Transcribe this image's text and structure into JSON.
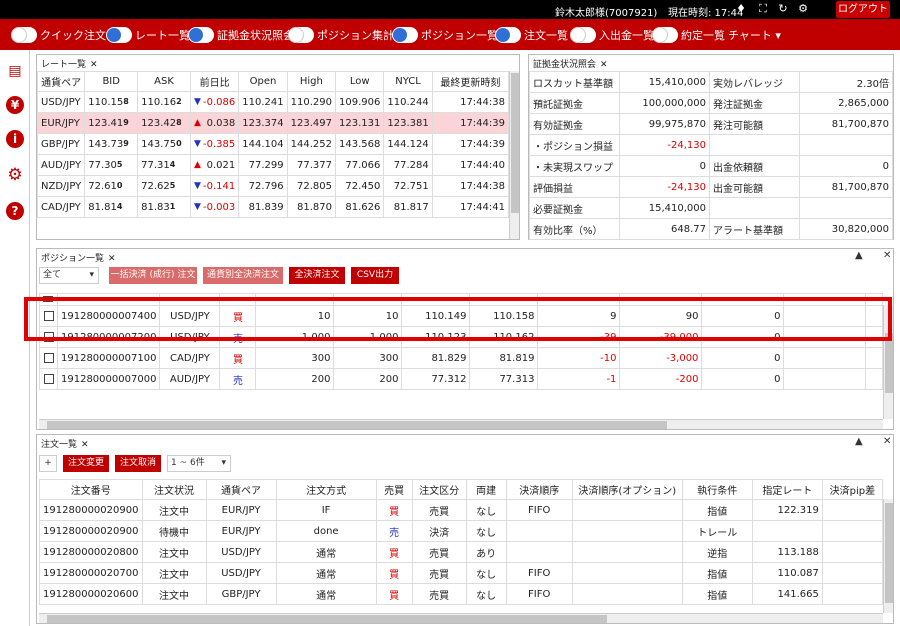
{
  "topbar": {
    "user": "鈴木太郎様(7007921)",
    "clock_label": "現在時刻: 17:44",
    "logout": "ログアウト",
    "icons": [
      "bell-icon",
      "fullscreen-icon",
      "refresh-icon",
      "gear-icon"
    ]
  },
  "toolbar": {
    "toggles": [
      {
        "label": "クイック注文",
        "on": false
      },
      {
        "label": "レート一覧",
        "on": true
      },
      {
        "label": "証拠金状況照会",
        "on": true
      },
      {
        "label": "ポジション集計",
        "on": false
      },
      {
        "label": "ポジション一覧",
        "on": true
      },
      {
        "label": "注文一覧",
        "on": true
      },
      {
        "label": "入出金一覧",
        "on": false
      },
      {
        "label": "約定一覧",
        "on": false
      }
    ],
    "chart_menu": "チャート ▾"
  },
  "sidebar": {
    "icons": [
      "save-icon",
      "yen-icon",
      "info-icon",
      "gear-icon",
      "help-icon"
    ]
  },
  "rate_panel": {
    "tab": "レート一覧",
    "headers": [
      "通貨ペア",
      "BID",
      "ASK",
      "前日比",
      "Open",
      "High",
      "Low",
      "NYCL",
      "最終更新時刻"
    ],
    "rows": [
      {
        "pair": "USD/JPY",
        "bid_main": "110.15",
        "bid_pip": "8",
        "ask_main": "110.16",
        "ask_pip": "2",
        "dir": "▼",
        "change": "-0.086",
        "open": "110.241",
        "high": "110.290",
        "low": "109.906",
        "nycl": "110.244",
        "time": "17:44:38"
      },
      {
        "pair": "EUR/JPY",
        "bid_main": "123.41",
        "bid_pip": "9",
        "ask_main": "123.42",
        "ask_pip": "8",
        "dir": "▲",
        "change": "0.038",
        "open": "123.374",
        "high": "123.497",
        "low": "123.131",
        "nycl": "123.381",
        "time": "17:44:39"
      },
      {
        "pair": "GBP/JPY",
        "bid_main": "143.73",
        "bid_pip": "9",
        "ask_main": "143.75",
        "ask_pip": "0",
        "dir": "▼",
        "change": "-0.385",
        "open": "144.104",
        "high": "144.252",
        "low": "143.568",
        "nycl": "144.124",
        "time": "17:44:39"
      },
      {
        "pair": "AUD/JPY",
        "bid_main": "77.30",
        "bid_pip": "5",
        "ask_main": "77.31",
        "ask_pip": "4",
        "dir": "▲",
        "change": "0.021",
        "open": "77.299",
        "high": "77.377",
        "low": "77.066",
        "nycl": "77.284",
        "time": "17:44:40"
      },
      {
        "pair": "NZD/JPY",
        "bid_main": "72.61",
        "bid_pip": "0",
        "ask_main": "72.62",
        "ask_pip": "5",
        "dir": "▼",
        "change": "-0.141",
        "open": "72.796",
        "high": "72.805",
        "low": "72.450",
        "nycl": "72.751",
        "time": "17:44:38"
      },
      {
        "pair": "CAD/JPY",
        "bid_main": "81.81",
        "bid_pip": "4",
        "ask_main": "81.83",
        "ask_pip": "1",
        "dir": "▼",
        "change": "-0.003",
        "open": "81.839",
        "high": "81.870",
        "low": "81.626",
        "nycl": "81.817",
        "time": "17:44:41"
      }
    ]
  },
  "margin_panel": {
    "tab": "証拠金状況照会",
    "rows": [
      [
        "ロスカット基準額",
        "15,410,000",
        "実効レバレッジ",
        "2.30倍"
      ],
      [
        "預託証拠金",
        "100,000,000",
        "発注証拠金",
        "2,865,000"
      ],
      [
        "有効証拠金",
        "99,975,870",
        "発注可能額",
        "81,700,870"
      ],
      [
        "・ポジション損益",
        "-24,130",
        "",
        ""
      ],
      [
        "・未実現スワップ",
        "0",
        "出金依頼額",
        "0"
      ],
      [
        "評価損益",
        "-24,130",
        "出金可能額",
        "81,700,870"
      ],
      [
        "必要証拠金",
        "15,410,000",
        "",
        ""
      ],
      [
        "有効比率（%）",
        "648.77",
        "アラート基準額",
        "30,820,000"
      ]
    ]
  },
  "position_panel": {
    "tab": "ポジション一覧",
    "filter": "全て",
    "buttons": [
      "一括決済 (成行) 注文",
      "通貨別全決済注文",
      "全決済注文",
      "CSV出力"
    ],
    "rows": [
      {
        "id": "191280000007400",
        "pair": "USD/JPY",
        "side": "買",
        "lots": "10",
        "qty": "10",
        "rate": "110.149",
        "eval": "110.158",
        "pips": "9",
        "pl": "90",
        "swap": "0"
      },
      {
        "id": "191280000007200",
        "pair": "USD/JPY",
        "side": "売",
        "lots": "1,000",
        "qty": "1,000",
        "rate": "110.123",
        "eval": "110.162",
        "pips": "-39",
        "pl": "-39,000",
        "swap": "0"
      },
      {
        "id": "191280000007100",
        "pair": "CAD/JPY",
        "side": "買",
        "lots": "300",
        "qty": "300",
        "rate": "81.829",
        "eval": "81.819",
        "pips": "-10",
        "pl": "-3,000",
        "swap": "0"
      },
      {
        "id": "191280000007000",
        "pair": "AUD/JPY",
        "side": "売",
        "lots": "200",
        "qty": "200",
        "rate": "77.312",
        "eval": "77.313",
        "pips": "-1",
        "pl": "-200",
        "swap": "0"
      }
    ]
  },
  "order_panel": {
    "tab": "注文一覧",
    "add": "+",
    "buttons": [
      "注文変更",
      "注文取消"
    ],
    "range": "1 ~ 6件",
    "headers": [
      "注文番号",
      "注文状況",
      "通貨ペア",
      "注文方式",
      "売買",
      "注文区分",
      "両建",
      "決済順序",
      "決済順序(オプション)",
      "執行条件",
      "指定レート",
      "決済pip差"
    ],
    "rows": [
      {
        "id": "191280000020900",
        "status": "注文中",
        "pair": "EUR/JPY",
        "type": "IF",
        "side": "買",
        "kind": "売買",
        "hedge": "なし",
        "order": "FIFO",
        "opt": "",
        "cond": "指値",
        "rate": "122.319"
      },
      {
        "id": "191280000020900",
        "status": "待機中",
        "pair": "EUR/JPY",
        "type": "done",
        "side": "売",
        "kind": "決済",
        "hedge": "なし",
        "order": "",
        "opt": "",
        "cond": "トレール",
        "rate": ""
      },
      {
        "id": "191280000020800",
        "status": "注文中",
        "pair": "USD/JPY",
        "type": "通常",
        "side": "買",
        "kind": "売買",
        "hedge": "あり",
        "order": "",
        "opt": "",
        "cond": "逆指",
        "rate": "113.188"
      },
      {
        "id": "191280000020700",
        "status": "注文中",
        "pair": "USD/JPY",
        "type": "通常",
        "side": "買",
        "kind": "売買",
        "hedge": "なし",
        "order": "FIFO",
        "opt": "",
        "cond": "指値",
        "rate": "110.087"
      },
      {
        "id": "191280000020600",
        "status": "注文中",
        "pair": "GBP/JPY",
        "type": "通常",
        "side": "買",
        "kind": "売買",
        "hedge": "なし",
        "order": "FIFO",
        "opt": "",
        "cond": "指値",
        "rate": "141.665"
      }
    ]
  }
}
